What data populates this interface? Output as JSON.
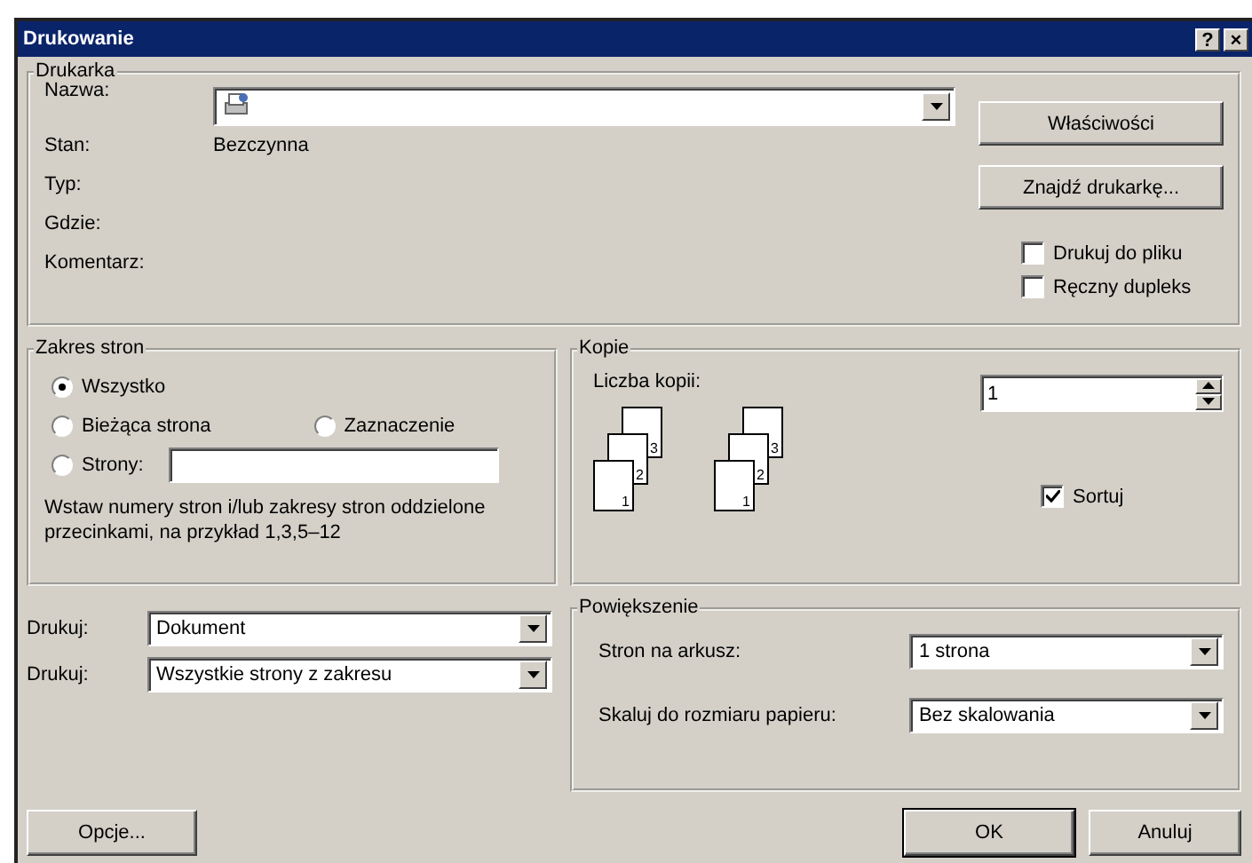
{
  "window": {
    "title": "Drukowanie",
    "help": "?",
    "close": "×"
  },
  "printer": {
    "legend": "Drukarka",
    "fields": [
      {
        "kind": "combo",
        "label": "Nazwa:"
      },
      {
        "kind": "text",
        "label": "Stan:",
        "value": "Bezczynna"
      },
      {
        "kind": "text",
        "label": "Typ:"
      },
      {
        "kind": "text",
        "label": "Gdzie:"
      },
      {
        "kind": "text",
        "label": "Komentarz:"
      }
    ],
    "buttons": [
      "Właściwości",
      "Znajdź drukarkę..."
    ],
    "checkboxes": [
      {
        "label": "Drukuj do pliku",
        "checked": false
      },
      {
        "label": "Ręczny dupleks",
        "checked": false
      }
    ]
  },
  "range": {
    "legend": "Zakres stron",
    "options": [
      {
        "kind": "radio",
        "label": "Wszystko",
        "selected": true
      },
      {
        "kind": "radio",
        "label": "Bieżąca strona",
        "selected": false
      },
      {
        "kind": "radio",
        "label": "Zaznaczenie",
        "selected": false
      },
      {
        "kind": "field",
        "label": "Strony:",
        "selected": false
      }
    ],
    "hint": "Wstaw numery stron i/lub zakresy stron oddzielone przecinkami, na przykład 1,3,5–12"
  },
  "copies": {
    "legend": "Kopie",
    "label": "Liczba kopii:",
    "value": "1",
    "stacks": [
      {
        "pages": [
          "3",
          "2",
          "1"
        ]
      },
      {
        "pages": [
          "3",
          "2",
          "1"
        ]
      }
    ],
    "collate": {
      "label": "Sortuj",
      "checked": true
    }
  },
  "print_selects": [
    {
      "label": "Drukuj:",
      "value": "Dokument"
    },
    {
      "label": "Drukuj:",
      "value": "Wszystkie strony z zakresu"
    }
  ],
  "zoom": {
    "legend": "Powiększenie",
    "rows": [
      {
        "label": "Stron na arkusz:",
        "value": "1 strona"
      },
      {
        "label": "Skaluj do rozmiaru papieru:",
        "value": "Bez skalowania"
      }
    ]
  },
  "buttons": [
    {
      "label": "Opcje...",
      "default": false
    },
    {
      "label": "OK",
      "default": true
    },
    {
      "label": "Anuluj",
      "default": false
    }
  ]
}
